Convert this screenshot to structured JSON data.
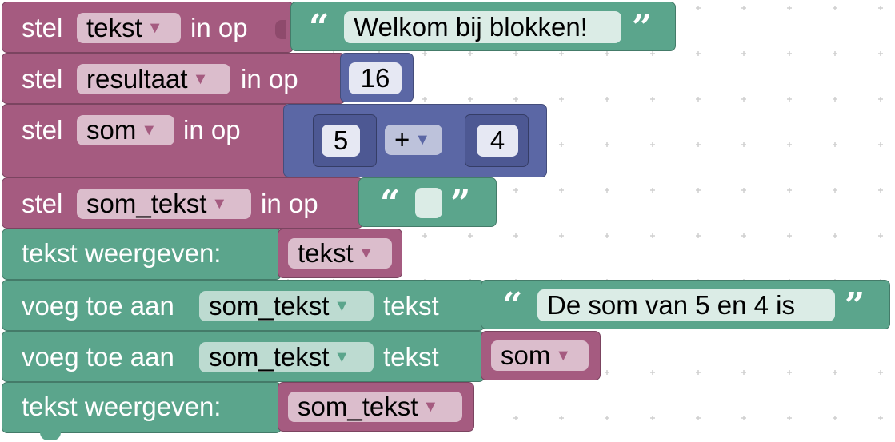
{
  "blocks": {
    "set1": {
      "stel": "stel",
      "var": "tekst",
      "in_op": "in op",
      "string": "Welkom bij blokken!"
    },
    "set2": {
      "stel": "stel",
      "var": "resultaat",
      "in_op": "in op",
      "number": "16"
    },
    "set3": {
      "stel": "stel",
      "var": "som",
      "in_op": "in op",
      "left": "5",
      "op": "+",
      "right": "4"
    },
    "set4": {
      "stel": "stel",
      "var": "som_tekst",
      "in_op": "in op",
      "string": ""
    },
    "print1": {
      "label": "tekst weergeven:",
      "var": "tekst"
    },
    "append1": {
      "voeg": "voeg toe aan",
      "var": "som_tekst",
      "tekst": "tekst",
      "string": "De som van 5 en 4 is "
    },
    "append2": {
      "voeg": "voeg toe aan",
      "var": "som_tekst",
      "tekst": "tekst",
      "value_var": "som"
    },
    "print2": {
      "label": "tekst weergeven:",
      "var": "som_tekst"
    }
  },
  "symbols": {
    "dropdown": "▼",
    "open_quote": "“",
    "close_quote": "”"
  },
  "colors": {
    "variables": "#a55b80",
    "text": "#5ba58c",
    "math": "#5b67a5"
  }
}
